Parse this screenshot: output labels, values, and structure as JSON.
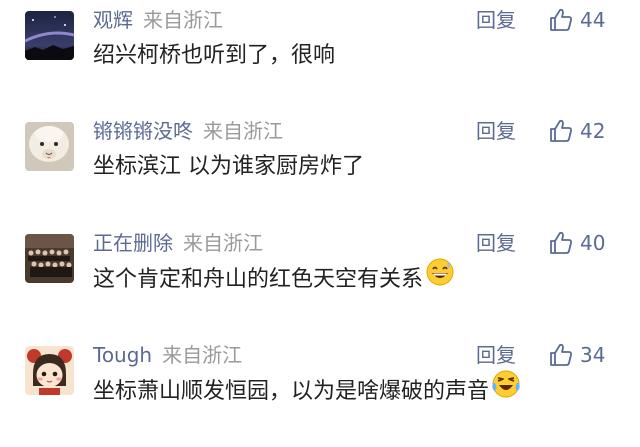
{
  "comments": [
    {
      "username": "观辉",
      "source": "来自浙江",
      "reply_label": "回复",
      "likes": "44",
      "text": "绍兴柯桥也听到了，很响",
      "avatar": "night-sky-avatar",
      "emoji": null
    },
    {
      "username": "锵锵锵没咚",
      "source": "来自浙江",
      "reply_label": "回复",
      "likes": "42",
      "text": "坐标滨江 以为谁家厨房炸了",
      "avatar": "alpaca-avatar",
      "emoji": null
    },
    {
      "username": "正在删除",
      "source": "来自浙江",
      "reply_label": "回复",
      "likes": "40",
      "text": "这个肯定和舟山的红色天空有关系",
      "avatar": "group-photo-avatar",
      "emoji": "grinning-sweat-emoji"
    },
    {
      "username": "Tough",
      "source": "来自浙江",
      "reply_label": "回复",
      "likes": "34",
      "text": "坐标萧山顺发恒园，以为是啥爆破的声音",
      "avatar": "cartoon-girl-avatar",
      "emoji": "laughing-tears-emoji"
    }
  ],
  "colors": {
    "username": "#5b6b93",
    "source": "#9a9a9a",
    "text": "#222222",
    "action": "#5b6b93"
  }
}
